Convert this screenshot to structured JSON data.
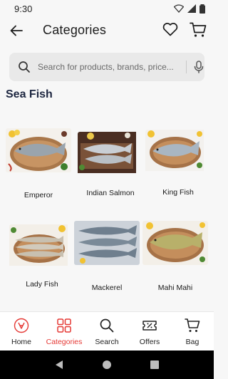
{
  "status": {
    "time": "9:30"
  },
  "header": {
    "title": "Categories"
  },
  "search": {
    "placeholder": "Search for products, brands, price..."
  },
  "section": {
    "title": "Sea Fish"
  },
  "categories": [
    {
      "name": "Emperor",
      "fish_color": "#9aa4ad",
      "board": "wood"
    },
    {
      "name": "Indian Salmon",
      "fish_color": "#c9ced4",
      "board": "dark-wood"
    },
    {
      "name": "King Fish",
      "fish_color": "#a9b6c2",
      "board": "wood"
    },
    {
      "name": "Lady Fish",
      "fish_color": "#c8c0b0",
      "board": "wood"
    },
    {
      "name": "Mackerel",
      "fish_color": "#6f7f8e",
      "board": "ice"
    },
    {
      "name": "Mahi Mahi",
      "fish_color": "#b8b06a",
      "board": "wood"
    }
  ],
  "bottom_nav": [
    {
      "label": "Home",
      "icon": "home-icon",
      "active": false
    },
    {
      "label": "Categories",
      "icon": "categories-icon",
      "active": true
    },
    {
      "label": "Search",
      "icon": "search-icon",
      "active": false
    },
    {
      "label": "Offers",
      "icon": "offers-icon",
      "active": false
    },
    {
      "label": "Bag",
      "icon": "bag-icon",
      "active": false
    }
  ],
  "colors": {
    "accent": "#e53935",
    "section_title": "#1d2640",
    "search_bg": "#e9e9e9"
  }
}
